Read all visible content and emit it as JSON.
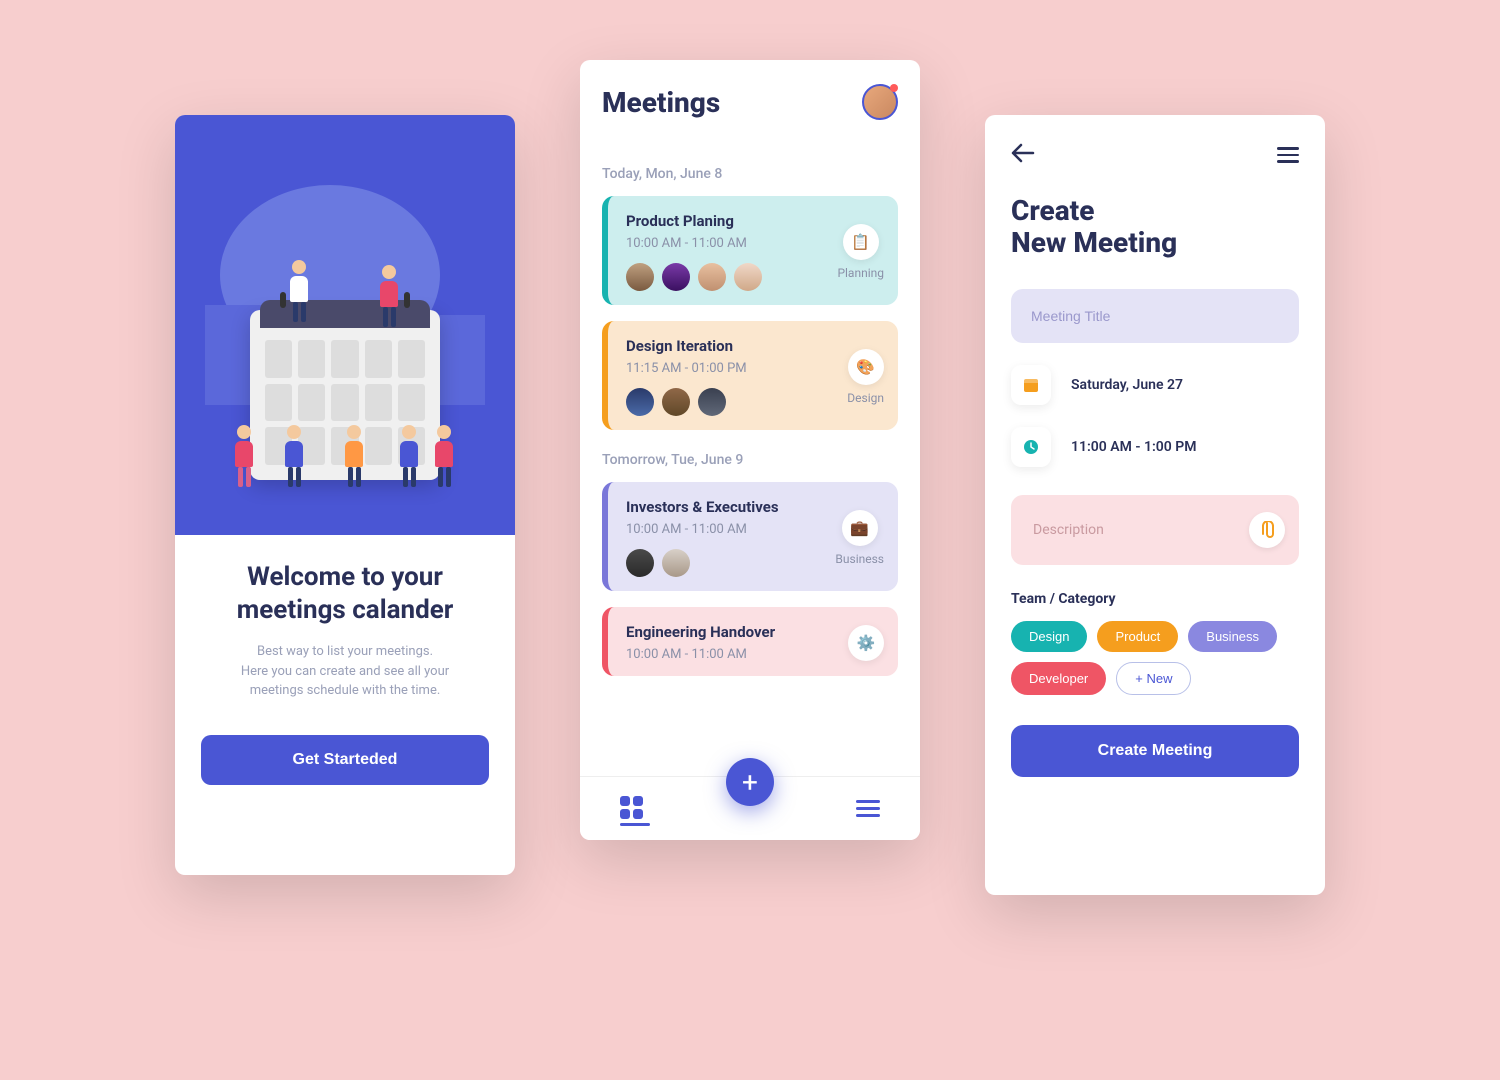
{
  "screen1": {
    "title": "Welcome to your meetings calander",
    "subtitle": "Best way to list your meetings.\nHere you can create and see all your\nmeetings schedule with the time.",
    "cta": "Get Starteded"
  },
  "screen2": {
    "header_title": "Meetings",
    "today_label": "Today, Mon, June 8",
    "tomorrow_label": "Tomorrow, Tue, June 9",
    "cards": [
      {
        "title": "Product Planing",
        "time": "10:00 AM - 11:00 AM",
        "tag": "Planning"
      },
      {
        "title": "Design Iteration",
        "time": "11:15 AM - 01:00 PM",
        "tag": "Design"
      },
      {
        "title": "Investors & Executives",
        "time": "10:00 AM - 11:00 AM",
        "tag": "Business"
      },
      {
        "title": "Engineering  Handover",
        "time": "10:00 AM - 11:00 AM",
        "tag": ""
      }
    ]
  },
  "screen3": {
    "title": "Create\nNew Meeting",
    "title_placeholder": "Meeting Title",
    "date": "Saturday, June 27",
    "time": "11:00 AM - 1:00 PM",
    "desc_placeholder": "Description",
    "category_label": "Team / Category",
    "pills": {
      "design": "Design",
      "product": "Product",
      "business": "Business",
      "developer": "Developer",
      "new": "+ New"
    },
    "create_btn": "Create Meeting"
  }
}
